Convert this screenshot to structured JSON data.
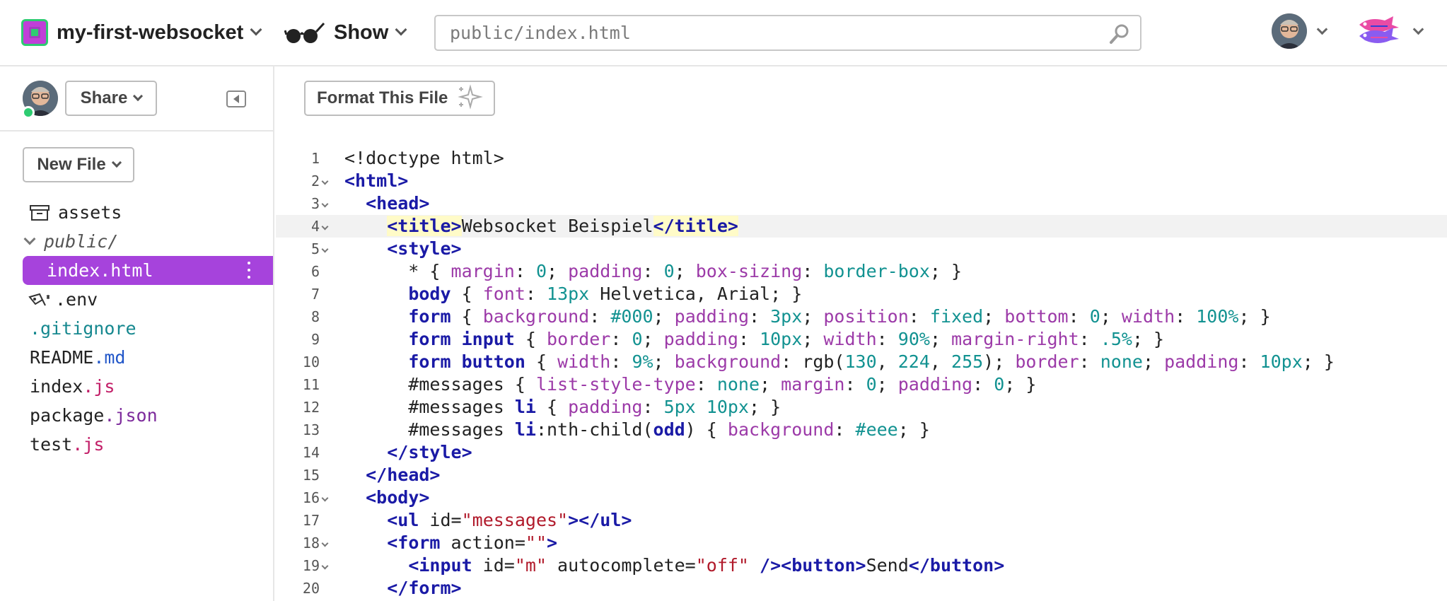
{
  "header": {
    "project_name": "my-first-websocket",
    "show_label": "Show",
    "search_placeholder": "public/index.html"
  },
  "sidebar": {
    "share_label": "Share",
    "new_file_label": "New File",
    "files": [
      {
        "name": "assets"
      },
      {
        "name": "public/"
      },
      {
        "name": "index.html"
      },
      {
        "name": ".env"
      },
      {
        "name": ".gitignore"
      },
      {
        "base": "README",
        "ext": ".md"
      },
      {
        "base": "index",
        "ext": ".js"
      },
      {
        "base": "package",
        "ext": ".json"
      },
      {
        "base": "test",
        "ext": ".js"
      }
    ]
  },
  "editor": {
    "format_label": "Format This File",
    "current_line": 4,
    "lines": [
      {
        "n": "1",
        "text": "<!doctype html>"
      },
      {
        "n": "2",
        "text": "<html>"
      },
      {
        "n": "3",
        "text": "  <head>"
      },
      {
        "n": "4",
        "text": "    <title>Websocket Beispiel</title>"
      },
      {
        "n": "5",
        "text": "    <style>"
      },
      {
        "n": "6",
        "text": "      * { margin: 0; padding: 0; box-sizing: border-box; }"
      },
      {
        "n": "7",
        "text": "      body { font: 13px Helvetica, Arial; }"
      },
      {
        "n": "8",
        "text": "      form { background: #000; padding: 3px; position: fixed; bottom: 0; width: 100%; }"
      },
      {
        "n": "9",
        "text": "      form input { border: 0; padding: 10px; width: 90%; margin-right: .5%; }"
      },
      {
        "n": "10",
        "text": "      form button { width: 9%; background: rgb(130, 224, 255); border: none; padding: 10px; }"
      },
      {
        "n": "11",
        "text": "      #messages { list-style-type: none; margin: 0; padding: 0; }"
      },
      {
        "n": "12",
        "text": "      #messages li { padding: 5px 10px; }"
      },
      {
        "n": "13",
        "text": "      #messages li:nth-child(odd) { background: #eee; }"
      },
      {
        "n": "14",
        "text": "    </style>"
      },
      {
        "n": "15",
        "text": "  </head>"
      },
      {
        "n": "16",
        "text": "  <body>"
      },
      {
        "n": "17",
        "text": "    <ul id=\"messages\"></ul>"
      },
      {
        "n": "18",
        "text": "    <form action=\"\">"
      },
      {
        "n": "19",
        "text": "      <input id=\"m\" autocomplete=\"off\" /><button>Send</button>"
      },
      {
        "n": "20",
        "text": "    </form>"
      }
    ]
  },
  "colors": {
    "accent": "#a643dc",
    "online": "#2ecc71",
    "tag": "#1a1aa6",
    "property": "#9c3aa8",
    "value": "#129291",
    "string": "#b11a2b"
  },
  "icons": [
    "project-icon",
    "glasses-icon",
    "search-icon",
    "chevron-down-icon",
    "avatar",
    "fish-logo-icon",
    "collapse-sidebar-icon",
    "folder-icon",
    "env-key-icon",
    "kebab-menu-icon",
    "sparkle-icon"
  ]
}
